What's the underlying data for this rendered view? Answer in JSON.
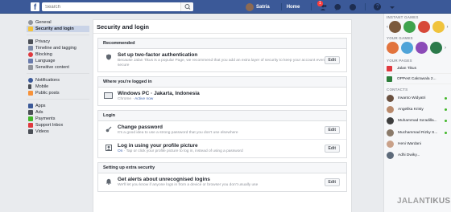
{
  "topbar": {
    "logo": "f",
    "search_placeholder": "Search",
    "user_name": "Satria",
    "home_label": "Home",
    "notification_count": "1",
    "help_label": "?"
  },
  "leftnav": {
    "groups": [
      [
        "General",
        "Security and login"
      ],
      [
        "Privacy",
        "Timeline and tagging",
        "Blocking",
        "Language",
        "Sensitive content"
      ],
      [
        "Notifications",
        "Mobile",
        "Public posts"
      ],
      [
        "Apps",
        "Ads",
        "Payments",
        "Support Inbox",
        "Videos"
      ]
    ],
    "active": "Security and login"
  },
  "main": {
    "title": "Security and login",
    "sections": [
      {
        "heading": "Recommended",
        "rows": [
          {
            "title": "Set up two-factor authentication",
            "desc": "Because Jalan Tikus is a popular Page, we recommend that you add an extra layer of security to keep your account even more secure",
            "edit": "Edit",
            "icon": "shield-icon"
          }
        ]
      },
      {
        "heading": "Where you're logged in",
        "rows": [
          {
            "title": "Windows PC · Jakarta, Indonesia",
            "desc_prefix": "Chrome · ",
            "desc_status": "Active now",
            "icon": "monitor-icon"
          }
        ]
      },
      {
        "heading": "Login",
        "rows": [
          {
            "title": "Change password",
            "desc": "It's a good idea to use a strong password that you don't use elsewhere",
            "edit": "Edit",
            "icon": "key-icon"
          },
          {
            "title": "Log in using your profile picture",
            "desc_status": "On",
            "desc": " · Tap or click your profile picture to log in, instead of using a password",
            "edit": "Edit",
            "icon": "profile-icon"
          }
        ]
      },
      {
        "heading": "Setting up extra security",
        "rows": [
          {
            "title": "Get alerts about unrecognised logins",
            "desc": "We'll let you know if anyone logs in from a device or browser you don't usually use",
            "edit": "Edit",
            "icon": "bell-icon"
          }
        ]
      }
    ]
  },
  "rightcol": {
    "instant_games": "INSTANT GAMES",
    "your_games": "YOUR GAMES",
    "your_pages": "YOUR PAGES",
    "pages": [
      "Jalan Tikus",
      "OPPest Cakrawala 2..."
    ],
    "contacts_heading": "CONTACTS",
    "contacts": [
      "Irwanto Widyatri",
      "Angelika Kristy",
      "Muhammad Sa'adilla...",
      "Muchammad Rizky S...",
      "Heni Wardani",
      "Adhi Dwiky..."
    ]
  },
  "watermark": {
    "a": "JALAN",
    "b": "TIKUS"
  },
  "colors": {
    "brand": "#3b5998",
    "online": "#42b72a",
    "active_nav": "#c9d3e7"
  }
}
